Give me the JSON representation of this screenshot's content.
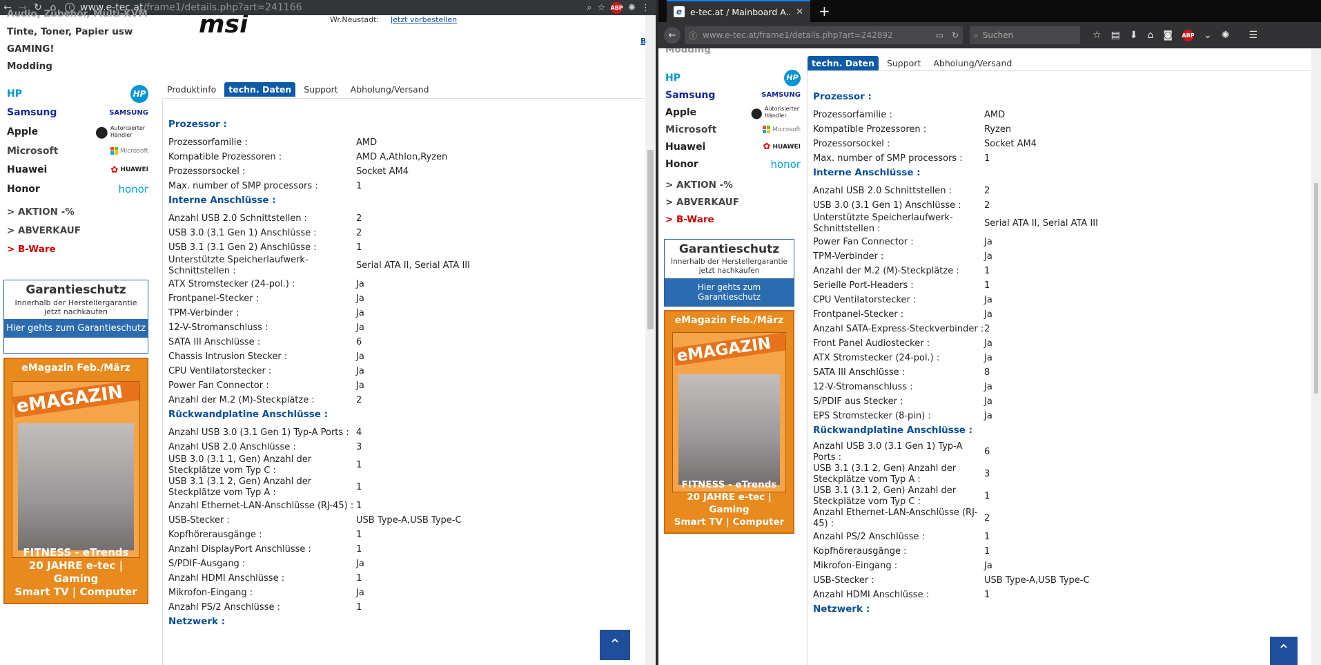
{
  "left": {
    "url": {
      "domain": "www.e-tec.at",
      "path": "/frame1/details.php?art=241166"
    },
    "sidebar": {
      "top_cut": "Audio, Zubehör, Multi-KVM",
      "links": [
        "Tinte, Toner, Papier usw",
        "GAMING!",
        "Modding"
      ],
      "brands": [
        {
          "name": "HP",
          "logo": "HP",
          "color": "#0096d6"
        },
        {
          "name": "Samsung",
          "logo": "SAMSUNG",
          "color": "#1428a0"
        },
        {
          "name": "Apple",
          "logo": "Autorisierter Händler",
          "color": "#111111"
        },
        {
          "name": "Microsoft",
          "logo": "Microsoft",
          "color": "#444444"
        },
        {
          "name": "Huawei",
          "logo": "HUAWEI",
          "color": "#111111"
        },
        {
          "name": "Honor",
          "logo": "honor",
          "color": "#111111"
        }
      ],
      "promos": [
        "> AKTION -%",
        "> ABVERKAUF",
        "> B-Ware"
      ],
      "garantie": {
        "title": "Garantieschutz",
        "sub": "Innerhalb der Herstellergarantie jetzt nachkaufen",
        "button": "Hier gehts zum Garantieschutz"
      },
      "emag": {
        "title": "eMagazin Feb./März",
        "cover": "eMAGAZIN",
        "caption": [
          "FITNESS - eTrends",
          "20 JAHRE e-tec | Gaming",
          "Smart TV | Computer"
        ]
      }
    },
    "header_partial": {
      "brand_logo": "msi",
      "location": "Wr.Neustadt:",
      "reserve_link": "Jetzt vorbestellen",
      "edge_mark": "B"
    },
    "tabs": [
      "Produktinfo",
      "techn. Daten",
      "Support",
      "Abholung/Versand"
    ],
    "active_tab": "techn. Daten",
    "sections": [
      {
        "title": "Prozessor :",
        "rows": [
          [
            "Prozessorfamilie :",
            "AMD"
          ],
          [
            "Kompatible Prozessoren :",
            "AMD A,Athlon,Ryzen"
          ],
          [
            "Prozessorsockel :",
            "Socket AM4"
          ],
          [
            "Max. number of SMP processors :",
            "1"
          ]
        ]
      },
      {
        "title": "Interne Anschlüsse :",
        "rows": [
          [
            "Anzahl USB 2.0 Schnittstellen :",
            "2"
          ],
          [
            "USB 3.0 (3.1 Gen 1) Anschlüsse :",
            "2"
          ],
          [
            "USB 3.1 (3.1 Gen 2) Anschlüsse :",
            "1"
          ],
          [
            "Unterstützte Speicherlaufwerk-Schnittstellen :",
            "Serial ATA II, Serial ATA III"
          ],
          [
            "ATX Stromstecker (24-pol.) :",
            "Ja"
          ],
          [
            "Frontpanel-Stecker :",
            "Ja"
          ],
          [
            "TPM-Verbinder :",
            "Ja"
          ],
          [
            "12-V-Stromanschluss :",
            "Ja"
          ],
          [
            "SATA III Anschlüsse :",
            "6"
          ],
          [
            "Chassis Intrusion Stecker :",
            "Ja"
          ],
          [
            "CPU Ventilatorstecker :",
            "Ja"
          ],
          [
            "Power Fan Connector :",
            "Ja"
          ],
          [
            "Anzahl der M.2 (M)-Steckplätze :",
            "2"
          ]
        ]
      },
      {
        "title": "Rückwandplatine Anschlüsse :",
        "rows": [
          [
            "Anzahl USB 3.0 (3.1 Gen 1) Typ-A Ports :",
            "4"
          ],
          [
            "Anzahl USB 2.0 Anschlüsse :",
            "3"
          ],
          [
            "USB 3.0 (3.1 1, Gen) Anzahl der Steckplätze vom Typ C :",
            "1"
          ],
          [
            "USB 3.1 (3.1 2, Gen) Anzahl der Steckplätze vom Typ A :",
            "1"
          ],
          [
            "Anzahl Ethernet-LAN-Anschlüsse (RJ-45) :",
            "1"
          ],
          [
            "USB-Stecker :",
            "USB Type-A,USB Type-C"
          ],
          [
            "Kopfhörerausgänge :",
            "1"
          ],
          [
            "Anzahl DisplayPort Anschlüsse :",
            "1"
          ],
          [
            "S/PDIF-Ausgang :",
            "Ja"
          ],
          [
            "Anzahl HDMI Anschlüsse :",
            "1"
          ],
          [
            "Mikrofon-Eingang :",
            "Ja"
          ],
          [
            "Anzahl PS/2 Anschlüsse :",
            "1"
          ]
        ]
      },
      {
        "title": "Netzwerk :",
        "rows": []
      }
    ]
  },
  "right": {
    "tab_title": "e-tec.at / Mainboard A...",
    "url": {
      "domain": "www.e-tec.at",
      "path": "/frame1/details.php?art=242892"
    },
    "search_placeholder": "Suchen",
    "sidebar": {
      "top_cut": "Modding",
      "brands": [
        {
          "name": "HP",
          "logo": "HP",
          "color": "#0096d6"
        },
        {
          "name": "Samsung",
          "logo": "SAMSUNG",
          "color": "#1428a0"
        },
        {
          "name": "Apple",
          "logo": "Autorisierter Händler",
          "color": "#111111"
        },
        {
          "name": "Microsoft",
          "logo": "Microsoft",
          "color": "#444444"
        },
        {
          "name": "Huawei",
          "logo": "HUAWEI",
          "color": "#111111"
        },
        {
          "name": "Honor",
          "logo": "honor",
          "color": "#111111"
        }
      ],
      "promos": [
        "> AKTION -%",
        "> ABVERKAUF",
        "> B-Ware"
      ],
      "garantie": {
        "title": "Garantieschutz",
        "sub": "Innerhalb der Herstellergarantie jetzt nachkaufen",
        "button": "Hier gehts zum Garantieschutz"
      },
      "emag": {
        "title": "eMagazin Feb./März",
        "cover": "eMAGAZIN",
        "caption": [
          "FITNESS - eTrends",
          "20 JAHRE e-tec | Gaming",
          "Smart TV | Computer"
        ]
      }
    },
    "tabs": [
      "techn. Daten",
      "Support",
      "Abholung/Versand"
    ],
    "active_tab": "techn. Daten",
    "sections": [
      {
        "title": "Prozessor :",
        "rows": [
          [
            "Prozessorfamilie :",
            "AMD"
          ],
          [
            "Kompatible Prozessoren :",
            "Ryzen"
          ],
          [
            "Prozessorsockel :",
            "Socket AM4"
          ],
          [
            "Max. number of SMP processors :",
            "1"
          ]
        ]
      },
      {
        "title": "Interne Anschlüsse :",
        "rows": [
          [
            "Anzahl USB 2.0 Schnittstellen :",
            "2"
          ],
          [
            "USB 3.0 (3.1 Gen 1) Anschlüsse :",
            "2"
          ],
          [
            "Unterstützte Speicherlaufwerk-Schnittstellen :",
            "Serial ATA II, Serial ATA III"
          ],
          [
            "Power Fan Connector :",
            "Ja"
          ],
          [
            "TPM-Verbinder :",
            "Ja"
          ],
          [
            "Anzahl der M.2 (M)-Steckplätze :",
            "1"
          ],
          [
            "Serielle Port-Headers :",
            "1"
          ],
          [
            "CPU Ventilatorstecker :",
            "Ja"
          ],
          [
            "Frontpanel-Stecker :",
            "Ja"
          ],
          [
            "Anzahl SATA-Express-Steckverbinder :",
            "2"
          ],
          [
            "Front Panel Audiostecker :",
            "Ja"
          ],
          [
            "ATX Stromstecker (24-pol.) :",
            "Ja"
          ],
          [
            "SATA III Anschlüsse :",
            "8"
          ],
          [
            "12-V-Stromanschluss :",
            "Ja"
          ],
          [
            "S/PDIF aus Stecker :",
            "Ja"
          ],
          [
            "EPS Stromstecker (8-pin) :",
            "Ja"
          ]
        ]
      },
      {
        "title": "Rückwandplatine Anschlüsse :",
        "rows": [
          [
            "Anzahl USB 3.0 (3.1 Gen 1) Typ-A Ports :",
            "6"
          ],
          [
            "USB 3.1 (3.1 2, Gen) Anzahl der Steckplätze vom Typ A :",
            "3"
          ],
          [
            "USB 3.1 (3.1 2, Gen) Anzahl der Steckplätze vom Typ C :",
            "1"
          ],
          [
            "Anzahl Ethernet-LAN-Anschlüsse (RJ-45) :",
            "2"
          ],
          [
            "Anzahl PS/2 Anschlüsse :",
            "1"
          ],
          [
            "Kopfhörerausgänge :",
            "1"
          ],
          [
            "Mikrofon-Eingang :",
            "Ja"
          ],
          [
            "USB-Stecker :",
            "USB Type-A,USB Type-C"
          ],
          [
            "Anzahl HDMI Anschlüsse :",
            "1"
          ]
        ]
      },
      {
        "title": "Netzwerk :",
        "rows": []
      }
    ]
  },
  "icons": {
    "scroll_top": "chevron-up-icon"
  }
}
